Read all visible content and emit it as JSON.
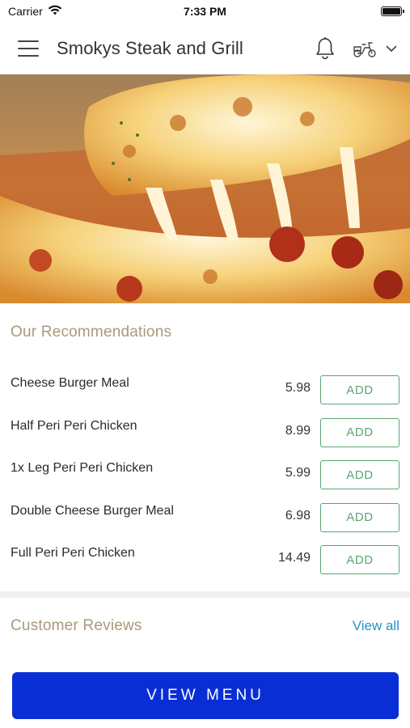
{
  "status_bar": {
    "carrier": "Carrier",
    "time": "7:33 PM"
  },
  "app_bar": {
    "title": "Smokys Steak and Grill"
  },
  "recommendations": {
    "title": "Our Recommendations",
    "items": [
      {
        "name": "Cheese Burger Meal",
        "price": "5.98",
        "action": "ADD"
      },
      {
        "name": "Half Peri Peri Chicken",
        "price": "8.99",
        "action": "ADD"
      },
      {
        "name": "1x Leg Peri Peri Chicken",
        "price": "5.99",
        "action": "ADD"
      },
      {
        "name": "Double Cheese Burger Meal",
        "price": "6.98",
        "action": "ADD"
      },
      {
        "name": "Full Peri Peri Chicken",
        "price": "14.49",
        "action": "ADD"
      }
    ]
  },
  "reviews": {
    "title": "Customer Reviews",
    "view_all": "View all"
  },
  "footer": {
    "view_menu": "VIEW MENU"
  },
  "colors": {
    "accent_green": "#5aa574",
    "primary_blue": "#0a2ed6",
    "link_blue": "#2196c7",
    "section_title": "#a89a7a"
  }
}
